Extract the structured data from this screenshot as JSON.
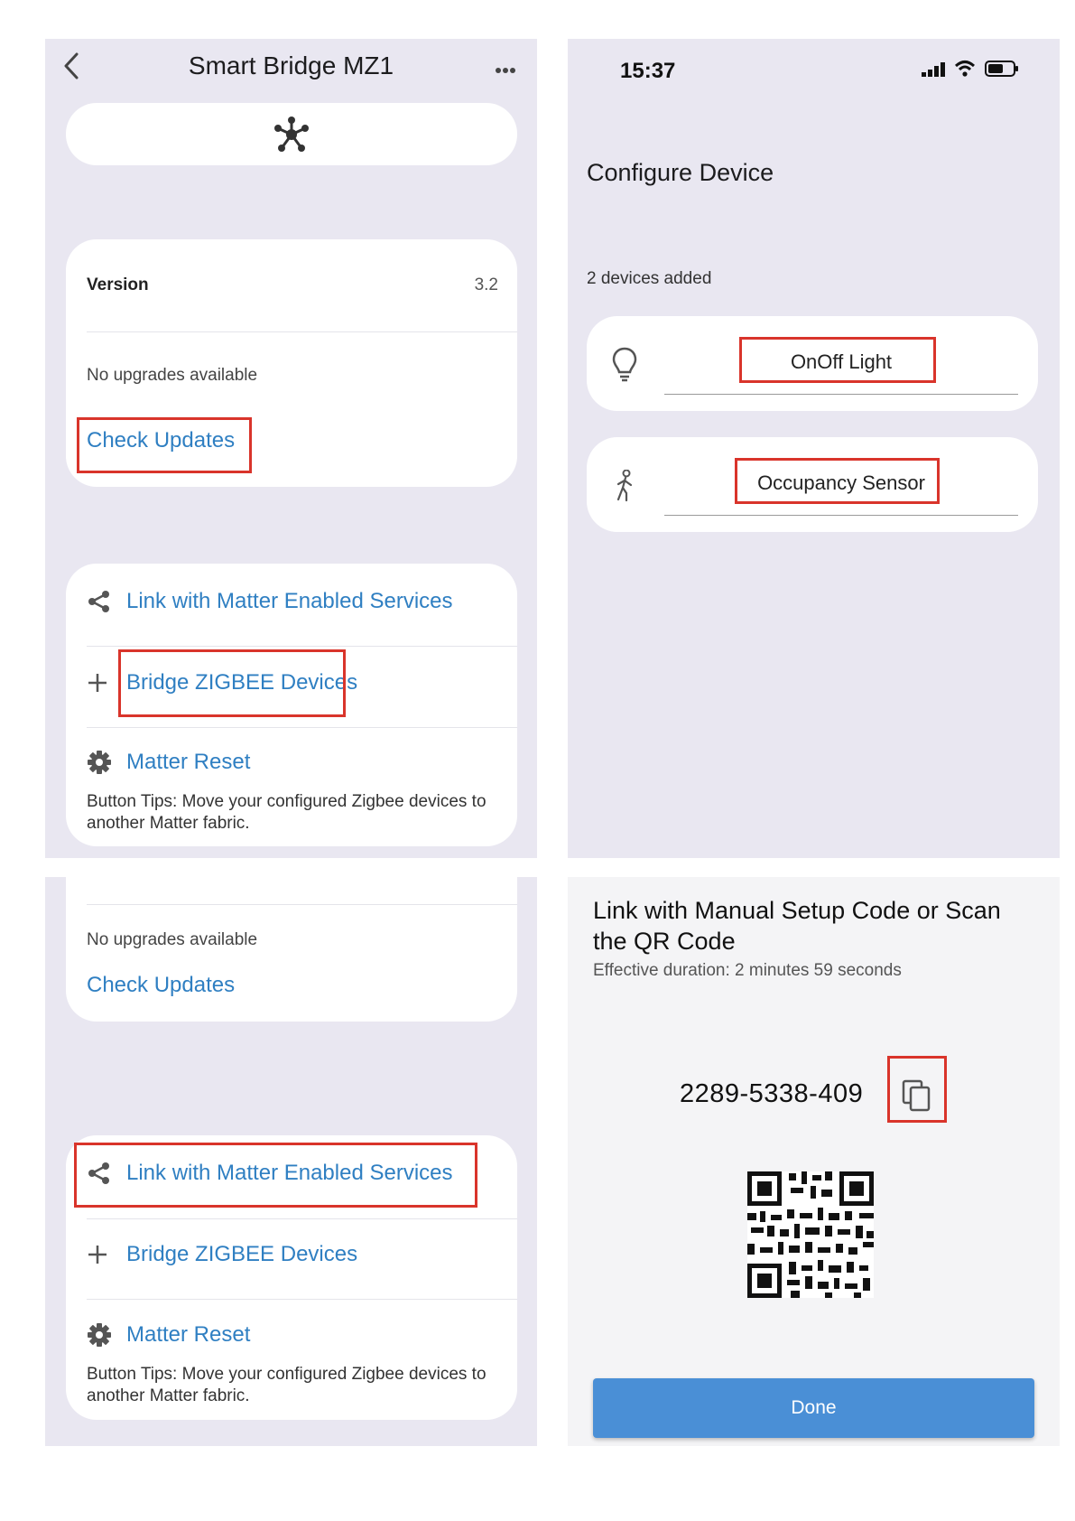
{
  "screen1": {
    "title": "Smart Bridge MZ1",
    "back_icon": "chevron-left-icon",
    "more_icon": "more-horizontal-icon",
    "hub_icon": "hub-icon",
    "version_label": "Version",
    "version_value": "3.2",
    "upgrade_status": "No upgrades available",
    "check_updates": "Check Updates",
    "actions": [
      {
        "icon": "share-icon",
        "label": "Link with Matter Enabled Services"
      },
      {
        "icon": "plus-icon",
        "label": "Bridge ZIGBEE Devices"
      },
      {
        "icon": "gear-icon",
        "label": "Matter Reset"
      }
    ],
    "tips": "Button Tips: Move your configured Zigbee devices to another Matter fabric."
  },
  "screen2": {
    "status_time": "15:37",
    "status_icons": [
      "signal-icon",
      "wifi-icon",
      "battery-icon"
    ],
    "title": "Configure Device",
    "devices_added": "2 devices added",
    "devices": [
      {
        "icon": "lightbulb-icon",
        "name": "OnOff Light"
      },
      {
        "icon": "walking-person-icon",
        "name": "Occupancy Sensor"
      }
    ]
  },
  "screen3": {
    "upgrade_status": "No upgrades available",
    "check_updates": "Check Updates",
    "actions": [
      {
        "icon": "share-icon",
        "label": "Link with Matter Enabled Services"
      },
      {
        "icon": "plus-icon",
        "label": "Bridge ZIGBEE Devices"
      },
      {
        "icon": "gear-icon",
        "label": "Matter Reset"
      }
    ],
    "tips": "Button Tips: Move your configured Zigbee devices to another Matter fabric."
  },
  "screen4": {
    "title": "Link with Manual Setup Code or Scan the QR Code",
    "duration": "Effective duration: 2 minutes 59 seconds",
    "setup_code": "2289-5338-409",
    "copy_icon": "copy-icon",
    "qr_icon": "qr-code-icon",
    "done": "Done"
  },
  "colors": {
    "panel_bg": "#e9e7f1",
    "link": "#2f7fc2",
    "highlight": "#d9342b",
    "done_button": "#4a8fd6"
  }
}
